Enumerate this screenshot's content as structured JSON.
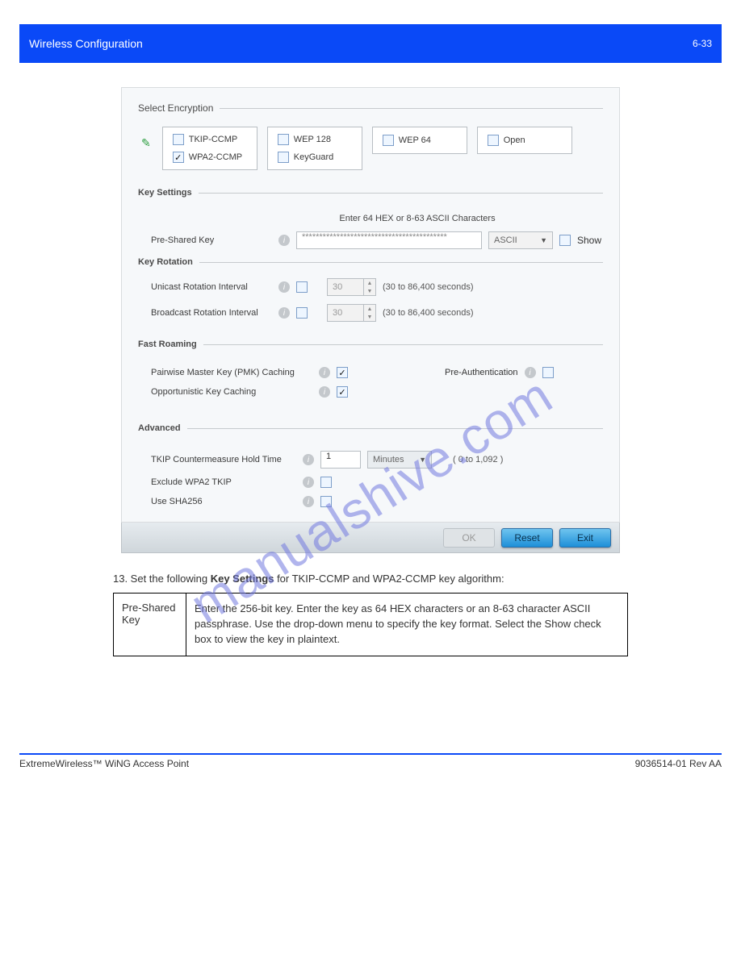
{
  "header": {
    "left": "Wireless Configuration",
    "right": "6-33"
  },
  "encryption": {
    "title": "Select Encryption",
    "options": {
      "tkip": "TKIP-CCMP",
      "wpa2": "WPA2-CCMP",
      "wep128": "WEP 128",
      "keyguard": "KeyGuard",
      "wep64": "WEP 64",
      "open": "Open"
    }
  },
  "key_settings": {
    "title": "Key Settings",
    "hint": "Enter 64 HEX or 8-63 ASCII Characters",
    "psk_label": "Pre-Shared Key",
    "psk_value": "******************************************",
    "format_selected": "ASCII",
    "show_label": "Show"
  },
  "key_rotation": {
    "title": "Key Rotation",
    "unicast_label": "Unicast Rotation Interval",
    "broadcast_label": "Broadcast Rotation Interval",
    "value": "30",
    "range": "(30 to 86,400 seconds)"
  },
  "fast_roaming": {
    "title": "Fast Roaming",
    "pmk_label": "Pairwise Master Key (PMK) Caching",
    "okc_label": "Opportunistic Key Caching",
    "preauth_label": "Pre-Authentication"
  },
  "advanced": {
    "title": "Advanced",
    "tkip_label": "TKIP Countermeasure Hold Time",
    "tkip_value": "1",
    "tkip_unit": "Minutes",
    "tkip_range": "( 0 to 1,092 )",
    "exclude_label": "Exclude WPA2 TKIP",
    "sha_label": "Use SHA256"
  },
  "buttons": {
    "ok": "OK",
    "reset": "Reset",
    "exit": "Exit"
  },
  "instruction": {
    "lead": "13. Set the following ",
    "bold": "Key Settings",
    "tail": " for TKIP-CCMP and WPA2-CCMP key algorithm:"
  },
  "table": {
    "term": "Pre-Shared Key",
    "definition": "Enter the 256-bit key. Enter the key as 64 HEX characters or an 8-63 character ASCII passphrase. Use the drop-down menu to specify the key format. Select the Show check box to view the key in plaintext."
  },
  "watermark": "manualshive.com",
  "footer": {
    "left": "ExtremeWireless™ WiNG Access Point",
    "right": "9036514-01 Rev AA"
  }
}
